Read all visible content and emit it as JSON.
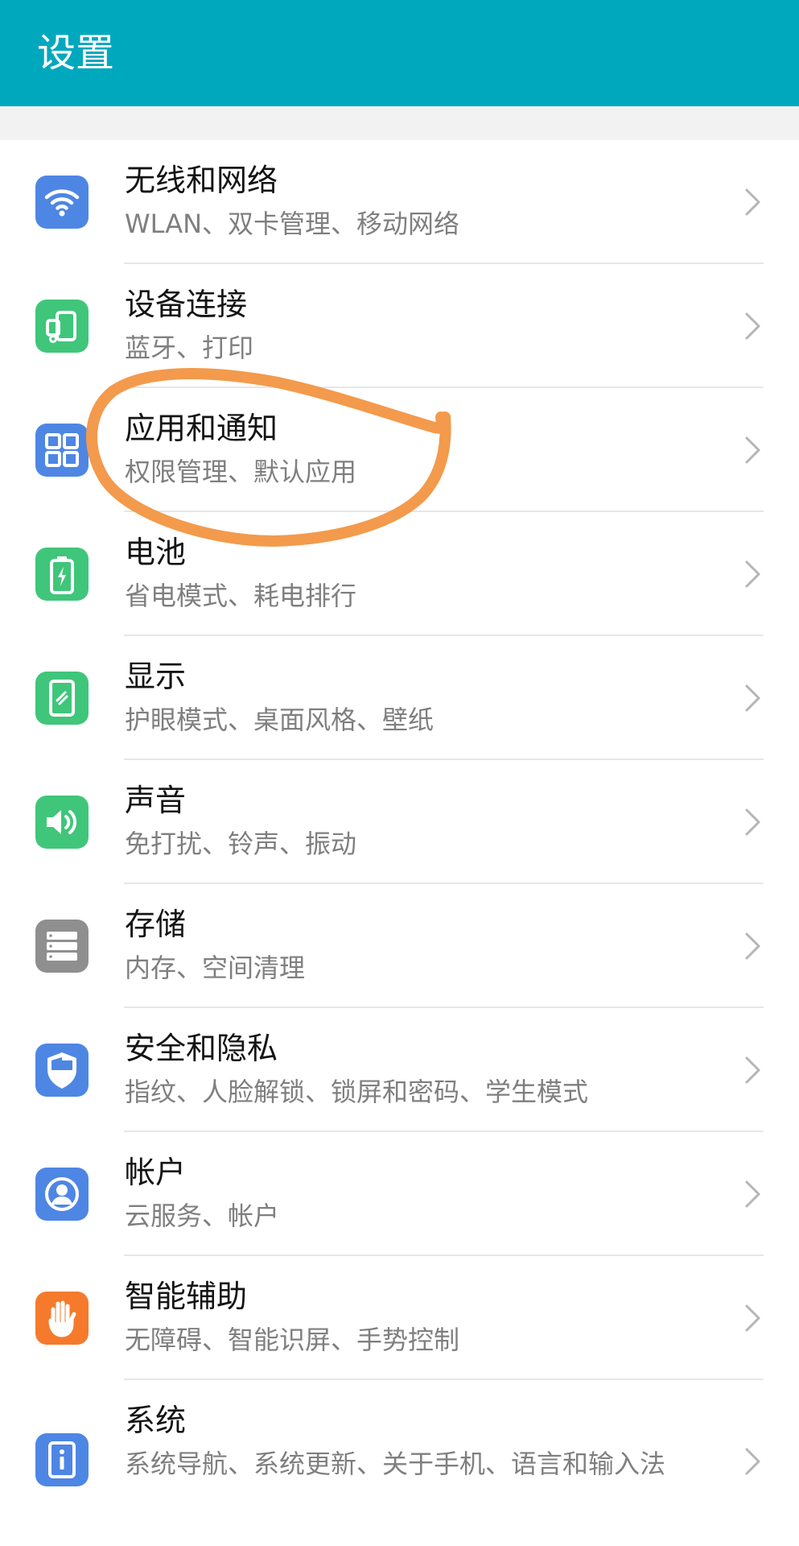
{
  "app_bar": {
    "title": "设置",
    "color": "#00a8be"
  },
  "items": [
    {
      "title": "无线和网络",
      "subtitle": "WLAN、双卡管理、移动网络",
      "icon": "wifi-icon",
      "color": "#4e86e4"
    },
    {
      "title": "设备连接",
      "subtitle": "蓝牙、打印",
      "icon": "device-connection-icon",
      "color": "#3fc67a"
    },
    {
      "title": "应用和通知",
      "subtitle": "权限管理、默认应用",
      "icon": "apps-grid-icon",
      "color": "#4e86e4"
    },
    {
      "title": "电池",
      "subtitle": "省电模式、耗电排行",
      "icon": "battery-icon",
      "color": "#3fc67a"
    },
    {
      "title": "显示",
      "subtitle": "护眼模式、桌面风格、壁纸",
      "icon": "display-icon",
      "color": "#3fc67a"
    },
    {
      "title": "声音",
      "subtitle": "免打扰、铃声、振动",
      "icon": "speaker-icon",
      "color": "#3fc67a"
    },
    {
      "title": "存储",
      "subtitle": "内存、空间清理",
      "icon": "storage-icon",
      "color": "#8f8f8f"
    },
    {
      "title": "安全和隐私",
      "subtitle": "指纹、人脸解锁、锁屏和密码、学生模式",
      "icon": "shield-icon",
      "color": "#4e86e4"
    },
    {
      "title": "帐户",
      "subtitle": "云服务、帐户",
      "icon": "account-icon",
      "color": "#4e86e4"
    },
    {
      "title": "智能辅助",
      "subtitle": "无障碍、智能识屏、手势控制",
      "icon": "hand-icon",
      "color": "#f57a2c"
    },
    {
      "title": "系统",
      "subtitle": "系统导航、系统更新、关于手机、语言和输入法",
      "icon": "system-info-icon",
      "color": "#4e86e4"
    }
  ],
  "annotation": {
    "color": "#f39a4c"
  }
}
